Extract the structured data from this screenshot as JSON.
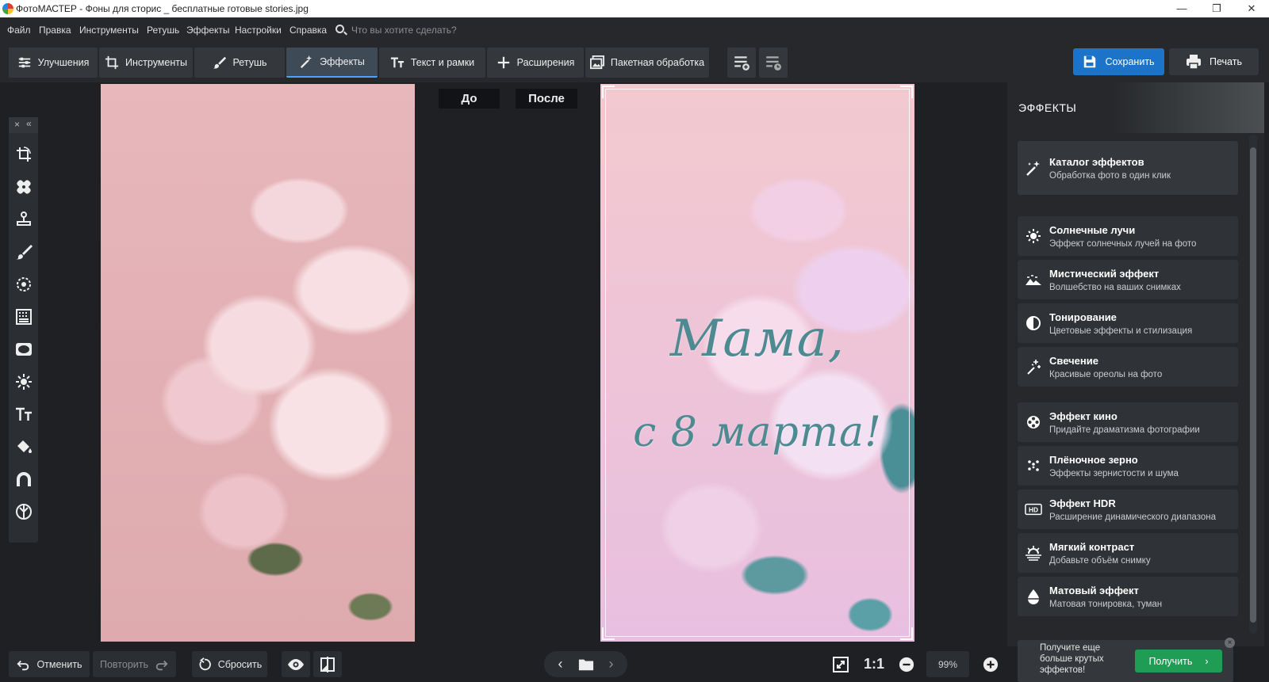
{
  "window": {
    "title": "ФотоМАСТЕР - Фоны для сторис _ бесплатные готовые stories.jpg",
    "minimize": "—",
    "restore": "❐",
    "close": "✕"
  },
  "menu": {
    "items": [
      "Файл",
      "Правка",
      "Инструменты",
      "Ретушь",
      "Эффекты",
      "Настройки",
      "Справка"
    ],
    "search_placeholder": "Что вы хотите сделать?"
  },
  "toolbar": {
    "tabs": [
      {
        "label": "Улучшения",
        "icon": "sliders-icon"
      },
      {
        "label": "Инструменты",
        "icon": "crop-icon"
      },
      {
        "label": "Ретушь",
        "icon": "brush-icon"
      },
      {
        "label": "Эффекты",
        "icon": "magic-wand-icon",
        "active": true
      },
      {
        "label": "Текст и рамки",
        "icon": "text-icon"
      },
      {
        "label": "Расширения",
        "icon": "plus-icon"
      },
      {
        "label": "Пакетная обработка",
        "icon": "batch-icon"
      }
    ],
    "save_label": "Сохранить",
    "print_label": "Печать"
  },
  "view": {
    "before_label": "До",
    "after_label": "После",
    "greeting_line1": "Мама,",
    "greeting_line2": "с 8 марта!"
  },
  "left_tools": {
    "close": "×",
    "collapse": "«",
    "tools": [
      "crop-rotate-icon",
      "patch-icon",
      "stamp-icon",
      "brush-icon",
      "radial-filter-icon",
      "gradient-filter-icon",
      "vignette-icon",
      "light-icon",
      "text-icon",
      "fill-icon",
      "magnet-icon",
      "mask-icon"
    ]
  },
  "effects_panel": {
    "title": "ЭФФЕКТЫ",
    "catalog": {
      "title": "Каталог эффектов",
      "subtitle": "Обработка фото в один клик"
    },
    "items": [
      {
        "title": "Солнечные лучи",
        "subtitle": "Эффект солнечных лучей на фото",
        "icon": "sun-icon"
      },
      {
        "title": "Мистический эффект",
        "subtitle": "Волшебство на ваших снимках",
        "icon": "landscape-icon"
      },
      {
        "title": "Тонирование",
        "subtitle": "Цветовые эффекты и стилизация",
        "icon": "half-circle-icon"
      },
      {
        "title": "Свечение",
        "subtitle": "Красивые ореолы на фото",
        "icon": "sparkle-icon"
      },
      {
        "title": "Эффект кино",
        "subtitle": "Придайте драматизма фотографии",
        "icon": "film-reel-icon"
      },
      {
        "title": "Плёночное зерно",
        "subtitle": "Эффекты зернистости и шума",
        "icon": "grain-icon"
      },
      {
        "title": "Эффект HDR",
        "subtitle": "Расширение динамического диапазона",
        "icon": "hdr-icon"
      },
      {
        "title": "Мягкий контраст",
        "subtitle": "Добавьте объём снимку",
        "icon": "soft-contrast-icon"
      },
      {
        "title": "Матовый эффект",
        "subtitle": "Матовая тонировка, туман",
        "icon": "drop-icon"
      }
    ]
  },
  "promo": {
    "text": "Получите еще больше крутых эффектов!",
    "button_label": "Получить"
  },
  "bottom": {
    "undo_label": "Отменить",
    "redo_label": "Повторить",
    "reset_label": "Сбросить",
    "zoom_1to1": "1:1",
    "zoom_value": "99%"
  },
  "colors": {
    "accent": "#1b74c9",
    "promo_green": "#1f9d55",
    "panel_bg": "#26282b",
    "canvas_bg": "#1e2023"
  }
}
